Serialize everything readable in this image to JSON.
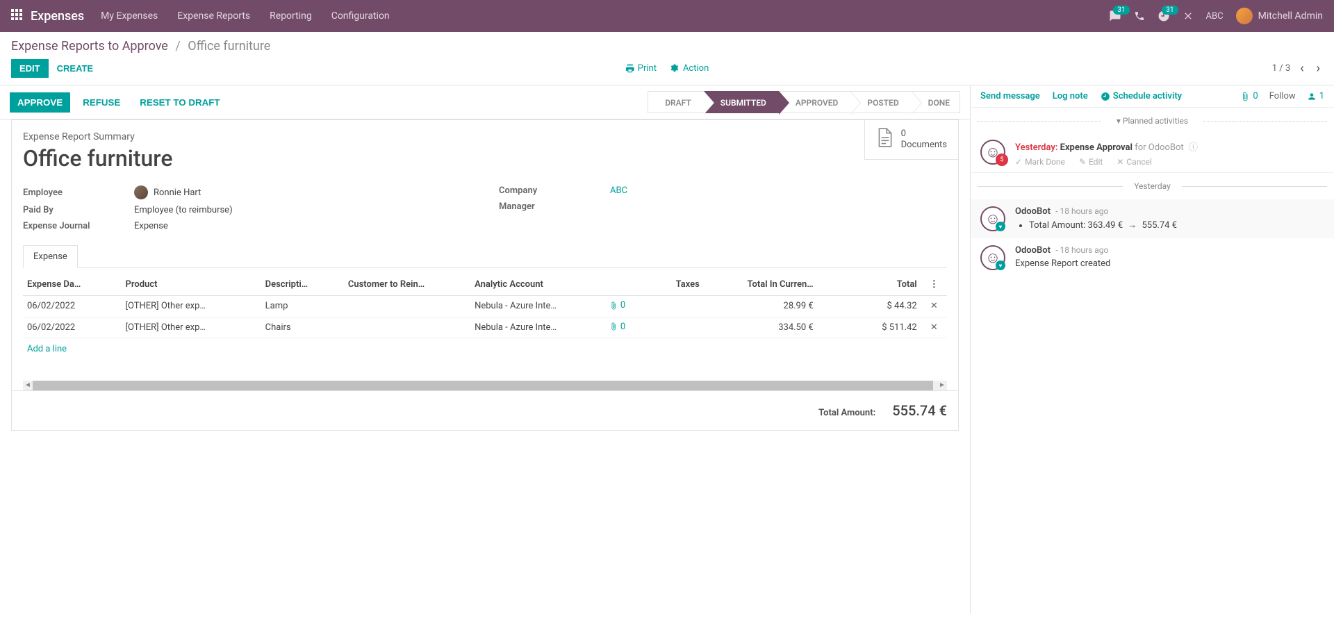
{
  "navbar": {
    "brand": "Expenses",
    "items": [
      "My Expenses",
      "Expense Reports",
      "Reporting",
      "Configuration"
    ],
    "msg_badge": "31",
    "activity_badge": "31",
    "company": "ABC",
    "user": "Mitchell Admin"
  },
  "breadcrumb": {
    "parent": "Expense Reports to Approve",
    "current": "Office furniture"
  },
  "buttons": {
    "edit": "EDIT",
    "create": "CREATE",
    "print": "Print",
    "action": "Action"
  },
  "pager": {
    "text": "1 / 3"
  },
  "statusbar": {
    "approve": "APPROVE",
    "refuse": "REFUSE",
    "reset": "RESET TO DRAFT",
    "steps": [
      "DRAFT",
      "SUBMITTED",
      "APPROVED",
      "POSTED",
      "DONE"
    ],
    "active_index": 1
  },
  "docbox": {
    "count": "0",
    "label": "Documents"
  },
  "summary_label": "Expense Report Summary",
  "title": "Office furniture",
  "fields": {
    "employee_l": "Employee",
    "employee_v": "Ronnie Hart",
    "paidby_l": "Paid By",
    "paidby_v": "Employee (to reimburse)",
    "journal_l": "Expense Journal",
    "journal_v": "Expense",
    "company_l": "Company",
    "company_v": "ABC",
    "manager_l": "Manager"
  },
  "tab": "Expense",
  "columns": {
    "date": "Expense Da…",
    "product": "Product",
    "desc": "Descripti…",
    "customer": "Customer to Rein…",
    "analytic": "Analytic Account",
    "taxes": "Taxes",
    "total_cur": "Total In Curren…",
    "total": "Total"
  },
  "lines": [
    {
      "date": "06/02/2022",
      "product": "[OTHER] Other exp…",
      "desc": "Lamp",
      "analytic": "Nebula - Azure Inte…",
      "attach": "0",
      "total_cur": "28.99 €",
      "total": "$ 44.32"
    },
    {
      "date": "06/02/2022",
      "product": "[OTHER] Other exp…",
      "desc": "Chairs",
      "analytic": "Nebula - Azure Inte…",
      "attach": "0",
      "total_cur": "334.50 €",
      "total": "$ 511.42"
    }
  ],
  "add_line": "Add a line",
  "totals": {
    "label": "Total Amount:",
    "value": "555.74 €"
  },
  "chatter": {
    "send": "Send message",
    "log": "Log note",
    "schedule": "Schedule activity",
    "attach_count": "0",
    "follow": "Follow",
    "followers": "1",
    "planned": "Planned activities",
    "activity": {
      "when": "Yesterday:",
      "title": "Expense Approval",
      "for": "for OdooBot",
      "done": "Mark Done",
      "edit": "Edit",
      "cancel": "Cancel"
    },
    "day": "Yesterday",
    "msg1": {
      "author": "OdooBot",
      "time": "- 18 hours ago",
      "change_prefix": "Total Amount: ",
      "change_from": "363.49 €",
      "change_to": "555.74 €"
    },
    "msg2": {
      "author": "OdooBot",
      "time": "- 18 hours ago",
      "text": "Expense Report created"
    }
  }
}
